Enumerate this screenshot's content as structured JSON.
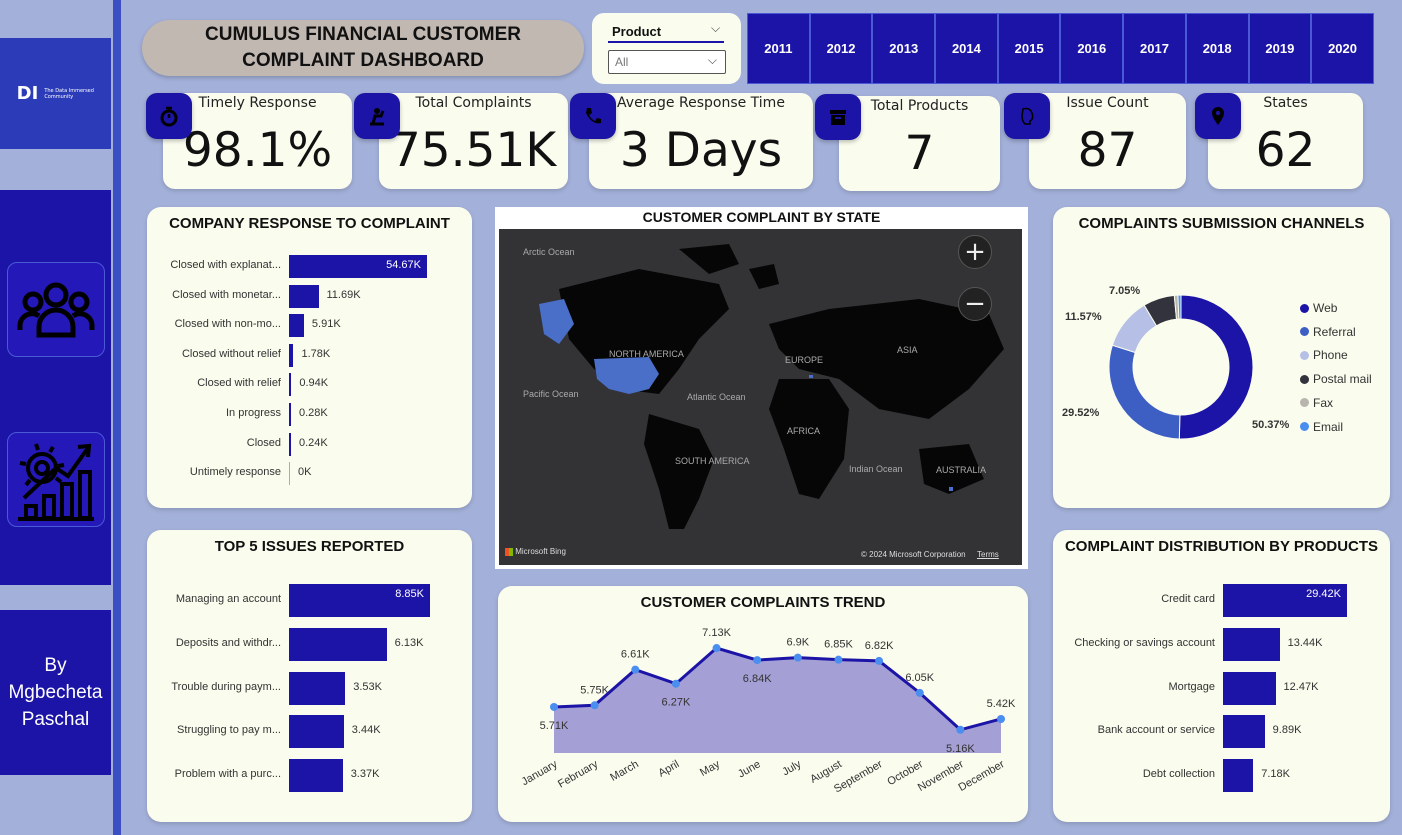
{
  "sidebar": {
    "logo_mark": "DI",
    "logo_text": "The Data Immersed Community",
    "author": "By Mgbecheta Paschal"
  },
  "header": {
    "title_line1": "CUMULUS FINANCIAL CUSTOMER",
    "title_line2": "COMPLAINT DASHBOARD"
  },
  "filter": {
    "label": "Product",
    "value": "All"
  },
  "years": [
    "2011",
    "2012",
    "2013",
    "2014",
    "2015",
    "2016",
    "2017",
    "2018",
    "2019",
    "2020"
  ],
  "kpis": {
    "timely": {
      "label": "Timely Response",
      "value": "98.1%"
    },
    "total": {
      "label": "Total Complaints",
      "value": "75.51K"
    },
    "avg": {
      "label": "Average Response Time",
      "value": "3 Days"
    },
    "products": {
      "label": "Total Products",
      "value": "7"
    },
    "issues": {
      "label": "Issue Count",
      "value": "87"
    },
    "states": {
      "label": "States",
      "value": "62"
    }
  },
  "response_panel": {
    "title": "COMPANY RESPONSE TO COMPLAINT",
    "rows": [
      {
        "label": "Closed with explanat...",
        "value": 54.67,
        "text": "54.67K"
      },
      {
        "label": "Closed with monetar...",
        "value": 11.69,
        "text": "11.69K"
      },
      {
        "label": "Closed with non-mo...",
        "value": 5.91,
        "text": "5.91K"
      },
      {
        "label": "Closed without relief",
        "value": 1.78,
        "text": "1.78K"
      },
      {
        "label": "Closed with relief",
        "value": 0.94,
        "text": "0.94K"
      },
      {
        "label": "In progress",
        "value": 0.28,
        "text": "0.28K"
      },
      {
        "label": "Closed",
        "value": 0.24,
        "text": "0.24K"
      },
      {
        "label": "Untimely response",
        "value": 0,
        "text": "0K"
      }
    ]
  },
  "issues_panel": {
    "title": "TOP 5 ISSUES REPORTED",
    "rows": [
      {
        "label": "Managing an account",
        "value": 8.85,
        "text": "8.85K"
      },
      {
        "label": "Deposits and withdr...",
        "value": 6.13,
        "text": "6.13K"
      },
      {
        "label": "Trouble during paym...",
        "value": 3.53,
        "text": "3.53K"
      },
      {
        "label": "Struggling to pay m...",
        "value": 3.44,
        "text": "3.44K"
      },
      {
        "label": "Problem with a purc...",
        "value": 3.37,
        "text": "3.37K"
      }
    ]
  },
  "products_panel": {
    "title": "COMPLAINT DISTRIBUTION BY PRODUCTS",
    "rows": [
      {
        "label": "Credit card",
        "value": 29.42,
        "text": "29.42K"
      },
      {
        "label": "Checking or savings account",
        "value": 13.44,
        "text": "13.44K"
      },
      {
        "label": "Mortgage",
        "value": 12.47,
        "text": "12.47K"
      },
      {
        "label": "Bank account or service",
        "value": 9.89,
        "text": "9.89K"
      },
      {
        "label": "Debt collection",
        "value": 7.18,
        "text": "7.18K"
      }
    ]
  },
  "map": {
    "title": "CUSTOMER COMPLAINT BY STATE",
    "labels": {
      "arctic": "Arctic Ocean",
      "north_america": "NORTH AMERICA",
      "europe": "EUROPE",
      "asia": "ASIA",
      "pacific": "Pacific Ocean",
      "atlantic": "Atlantic Ocean",
      "africa": "AFRICA",
      "south_america": "SOUTH AMERICA",
      "indian": "Indian Ocean",
      "australia": "AUSTRALIA"
    },
    "attribution": "Microsoft Bing",
    "copyright": "© 2024 Microsoft Corporation",
    "terms": "Terms",
    "zoom_in": "+",
    "zoom_out": "−"
  },
  "channels": {
    "title": "COMPLAINTS SUBMISSION CHANNELS",
    "slices": [
      {
        "name": "Web",
        "pct": 50.37,
        "label": "50.37%",
        "color": "#1c14a6"
      },
      {
        "name": "Referral",
        "pct": 29.52,
        "label": "29.52%",
        "color": "#3d5fc4"
      },
      {
        "name": "Phone",
        "pct": 11.57,
        "label": "11.57%",
        "color": "#b6c0e6"
      },
      {
        "name": "Postal mail",
        "pct": 7.05,
        "label": "7.05%",
        "color": "#33333d"
      },
      {
        "name": "Fax",
        "pct": 0.8,
        "label": "",
        "color": "#b8b4ae"
      },
      {
        "name": "Email",
        "pct": 0.69,
        "label": "",
        "color": "#4a8ef0"
      }
    ]
  },
  "chart_data": {
    "type": "area",
    "title": "CUSTOMER COMPLAINTS TREND",
    "categories": [
      "January",
      "February",
      "March",
      "April",
      "May",
      "June",
      "July",
      "August",
      "September",
      "October",
      "November",
      "December"
    ],
    "values": [
      5.71,
      5.75,
      6.61,
      6.27,
      7.13,
      6.84,
      6.9,
      6.85,
      6.82,
      6.05,
      5.16,
      5.42
    ],
    "value_labels": [
      "5.71K",
      "5.75K",
      "6.61K",
      "6.27K",
      "7.13K",
      "6.84K",
      "6.9K",
      "6.85K",
      "6.82K",
      "6.05K",
      "5.16K",
      "5.42K"
    ],
    "colors": {
      "line": "#1c14a6",
      "fill": "#a49fd4",
      "point": "#4a8ef0"
    }
  },
  "colors": {
    "primary": "#1c14a6",
    "background": "#a3b0d9",
    "card": "#fafcee"
  }
}
